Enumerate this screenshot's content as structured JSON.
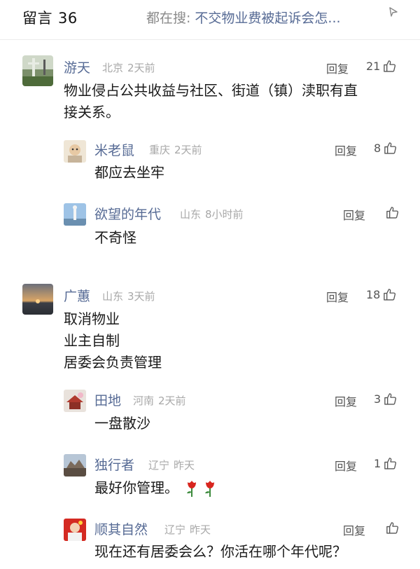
{
  "header": {
    "title": "留言",
    "count": "36",
    "search_prefix": "都在搜:",
    "search_query": "不交物业费被起诉会怎..."
  },
  "comments": [
    {
      "name": "游天",
      "location": "北京",
      "time": "2天前",
      "reply_label": "回复",
      "likes": "21",
      "content": [
        "物业侵占公共收益与社区、街道（镇）渎职有直",
        "接关系。"
      ],
      "replies": [
        {
          "name": "米老鼠",
          "location": "重庆",
          "time": "2天前",
          "reply_label": "回复",
          "likes": "8",
          "content": "都应去坐牢"
        },
        {
          "name": "欲望的年代",
          "location": "山东",
          "time": "8小时前",
          "reply_label": "回复",
          "likes": "",
          "content": "不奇怪"
        }
      ]
    },
    {
      "name": "广蕙",
      "location": "山东",
      "time": "3天前",
      "reply_label": "回复",
      "likes": "18",
      "content": [
        "取消物业",
        "业主自制",
        "居委会负责管理"
      ],
      "replies": [
        {
          "name": "田地",
          "location": "河南",
          "time": "2天前",
          "reply_label": "回复",
          "likes": "3",
          "content": "一盘散沙"
        },
        {
          "name": "独行者",
          "location": "辽宁",
          "time": "昨天",
          "reply_label": "回复",
          "likes": "1",
          "content": "最好你管理。"
        },
        {
          "name": "顺其自然",
          "location": "辽宁",
          "time": "昨天",
          "reply_label": "回复",
          "likes": "",
          "content": "现在还有居委会么？你活在哪个年代呢？"
        }
      ]
    }
  ],
  "icons": {
    "thumb": "thumbs-up-icon",
    "hint": "arrow-icon",
    "rose": "rose-emoji-icon"
  },
  "colors": {
    "name": "#576b95",
    "meta": "#a8a8a8",
    "text": "#1a1a1a"
  }
}
